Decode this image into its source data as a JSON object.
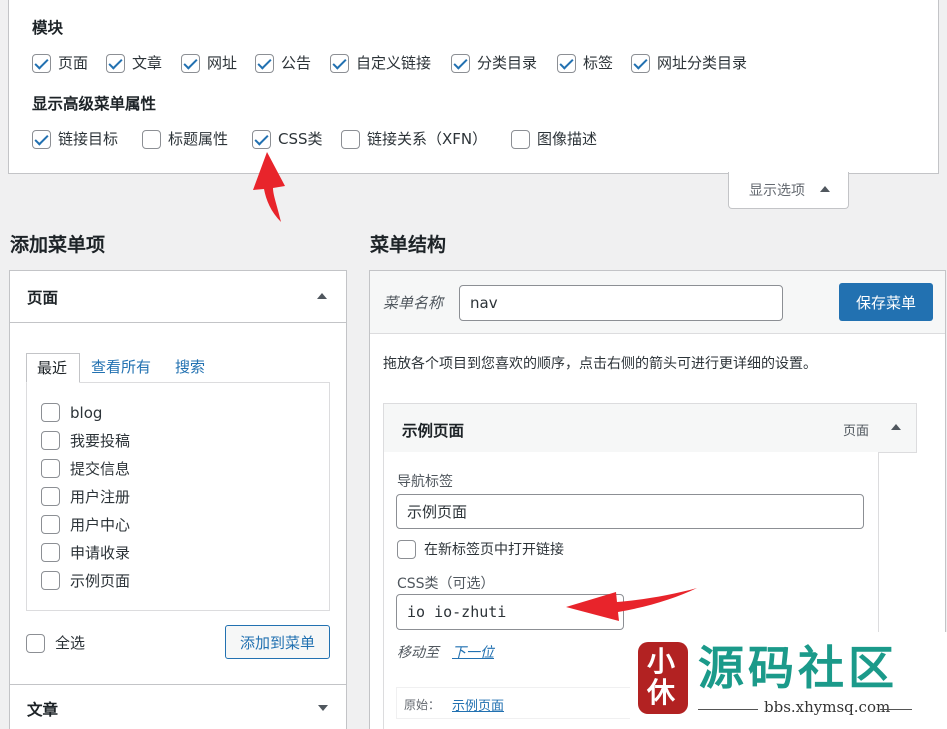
{
  "screen_options": {
    "modules_heading": "模块",
    "modules": [
      {
        "label": "页面",
        "checked": true
      },
      {
        "label": "文章",
        "checked": true
      },
      {
        "label": "网址",
        "checked": true
      },
      {
        "label": "公告",
        "checked": true
      },
      {
        "label": "自定义链接",
        "checked": true
      },
      {
        "label": "分类目录",
        "checked": true
      },
      {
        "label": "标签",
        "checked": true
      },
      {
        "label": "网址分类目录",
        "checked": true
      }
    ],
    "advanced_heading": "显示高级菜单属性",
    "advanced": [
      {
        "label": "链接目标",
        "checked": true
      },
      {
        "label": "标题属性",
        "checked": false
      },
      {
        "label": "CSS类",
        "checked": true
      },
      {
        "label": "链接关系（XFN）",
        "checked": false
      },
      {
        "label": "图像描述",
        "checked": false
      }
    ],
    "toggle_label": "显示选项"
  },
  "left": {
    "heading": "添加菜单项",
    "pages_box": {
      "title": "页面",
      "tabs": [
        "最近",
        "查看所有",
        "搜索"
      ],
      "items": [
        "blog",
        "我要投稿",
        "提交信息",
        "用户注册",
        "用户中心",
        "申请收录",
        "示例页面"
      ],
      "select_all": "全选",
      "add_button": "添加到菜单"
    },
    "posts_box_title": "文章"
  },
  "right": {
    "heading": "菜单结构",
    "menu_name_label": "菜单名称",
    "menu_name_value": "nav",
    "save_button": "保存菜单",
    "instructions": "拖放各个项目到您喜欢的顺序，点击右侧的箭头可进行更详细的设置。",
    "item": {
      "title": "示例页面",
      "type": "页面",
      "nav_label_caption": "导航标签",
      "nav_label_value": "示例页面",
      "new_tab_label": "在新标签页中打开链接",
      "css_caption": "CSS类（可选）",
      "css_value": "io io-zhuti",
      "move_label": "移动至",
      "move_link": "下一位",
      "original_label": "原始：",
      "original_link": "示例页面"
    }
  },
  "watermark": {
    "title": "源码社区",
    "url": "bbs.xhymsq.com",
    "seal": "小休"
  },
  "colors": {
    "accent": "#2271b1",
    "annotation_arrow": "#e8242b",
    "watermark": "#1b9a8a"
  }
}
